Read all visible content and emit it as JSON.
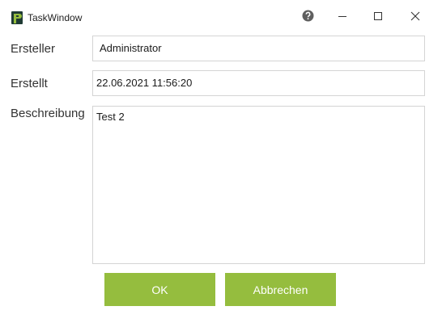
{
  "window": {
    "title": "TaskWindow"
  },
  "titlebar": {
    "icons": [
      "app-logo-icon",
      "help-icon",
      "minimize-icon",
      "maximize-icon",
      "close-icon"
    ]
  },
  "form": {
    "creator_label": "Ersteller",
    "creator_value": "Administrator",
    "created_label": "Erstellt",
    "created_value": "22.06.2021 11:56:20",
    "description_label": "Beschreibung",
    "description_value": "Test 2"
  },
  "buttons": {
    "ok_label": "OK",
    "cancel_label": "Abbrechen"
  },
  "colors": {
    "accent": "#95bd3e",
    "logo_dark": "#1f3b34",
    "logo_green": "#95bd3e",
    "field_border": "#d4d4d4"
  }
}
